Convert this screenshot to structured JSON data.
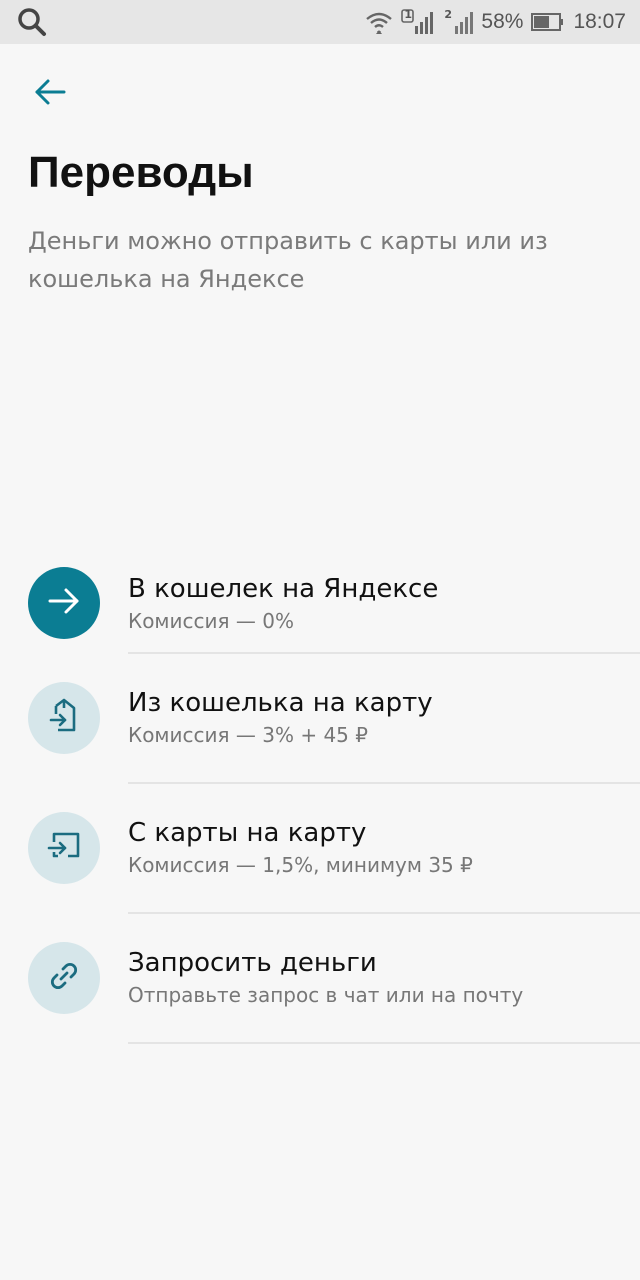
{
  "status_bar": {
    "battery_percent": "58%",
    "time": "18:07",
    "sim1_label": "1",
    "sim2_label": "2"
  },
  "header": {
    "title": "Переводы",
    "subtitle": "Деньги можно отправить с карты или из кошелька на Яндексе"
  },
  "options": [
    {
      "title": "В кошелек на Яндексе",
      "subtitle": "Комиссия — 0%",
      "icon": "arrow-right-icon"
    },
    {
      "title": "Из кошелька на карту",
      "subtitle": "Комиссия — 3% + 45 ₽",
      "icon": "wallet-to-card-icon"
    },
    {
      "title": "С карты на карту",
      "subtitle": "Комиссия — 1,5%, минимум 35 ₽",
      "icon": "card-to-card-icon"
    },
    {
      "title": "Запросить деньги",
      "subtitle": "Отправьте запрос в чат или на почту",
      "icon": "link-icon"
    }
  ],
  "colors": {
    "accent": "#0b7d93",
    "icon_bg_light": "#d6e6ea",
    "icon_fg": "#1b6c80",
    "background": "#f7f7f7",
    "status_bar_bg": "#e6e6e6"
  }
}
